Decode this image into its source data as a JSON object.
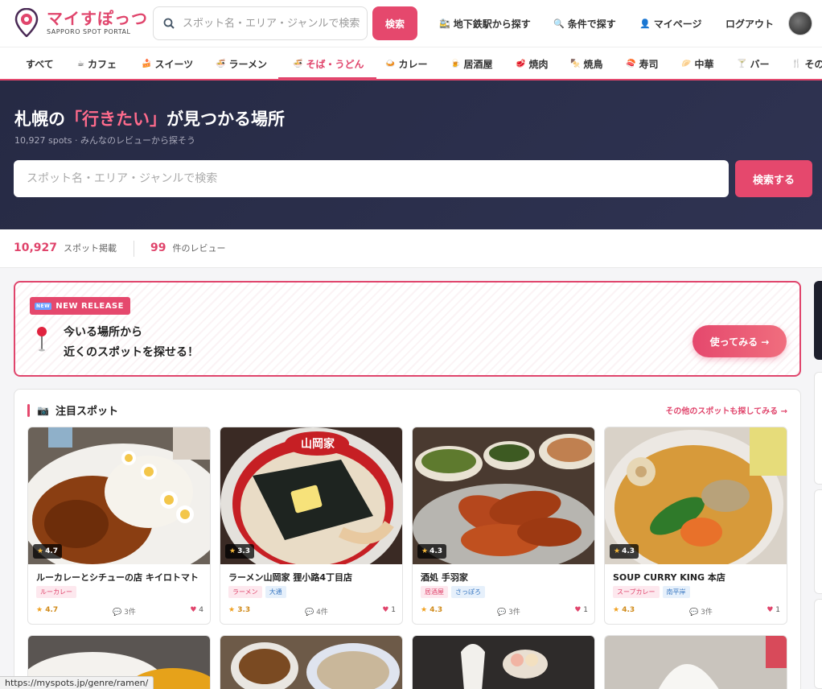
{
  "brand": {
    "name": "マイすぽっつ",
    "subtitle": "SAPPORO SPOT PORTAL"
  },
  "header": {
    "search_placeholder": "スポット名・エリア・ジャンルで検索",
    "search_button": "検索",
    "nav": [
      {
        "icon": "train-icon",
        "label": "地下鉄駅から探す"
      },
      {
        "icon": "search-icon",
        "label": "条件で探す"
      },
      {
        "icon": "user-icon",
        "label": "マイページ"
      },
      {
        "icon": "",
        "label": "ログアウト"
      }
    ]
  },
  "categories": [
    {
      "label": "すべて",
      "emoji": ""
    },
    {
      "label": "カフェ",
      "emoji": "☕"
    },
    {
      "label": "スイーツ",
      "emoji": "🍰"
    },
    {
      "label": "ラーメン",
      "emoji": "🍜"
    },
    {
      "label": "そば・うどん",
      "emoji": "🍜",
      "active": true
    },
    {
      "label": "カレー",
      "emoji": "🍛"
    },
    {
      "label": "居酒屋",
      "emoji": "🍺"
    },
    {
      "label": "焼肉",
      "emoji": "🥩"
    },
    {
      "label": "焼鳥",
      "emoji": "🍢"
    },
    {
      "label": "寿司",
      "emoji": "🍣"
    },
    {
      "label": "中華",
      "emoji": "🥟"
    },
    {
      "label": "バー",
      "emoji": "🍸"
    },
    {
      "label": "その",
      "emoji": "🍴"
    }
  ],
  "hero": {
    "title_pre": "札幌の",
    "title_highlight": "「行きたい」",
    "title_post": "が見つかる場所",
    "sub": "10,927 spots · みんなのレビューから探そう",
    "search_placeholder": "スポット名・エリア・ジャンルで検索",
    "search_button": "検索する"
  },
  "stats": [
    {
      "num": "10,927",
      "label": "スポット掲載"
    },
    {
      "num": "99",
      "label": "件のレビュー"
    }
  ],
  "release": {
    "badge_new": "NEW",
    "badge": "NEW RELEASE",
    "line1": "今いる場所から",
    "line2": "近くのスポットを探せる！",
    "button": "使ってみる →"
  },
  "featured": {
    "title": "注目スポット",
    "more": "その他のスポットも探してみる →",
    "cards": [
      {
        "name": "ルーカレーとシチューの店 キイロトマト",
        "rating": "4.7",
        "tags": [
          {
            "t": "ルーカレー",
            "c": "pink"
          }
        ],
        "reviews": "3件",
        "likes": "4"
      },
      {
        "name": "ラーメン山岡家 狸小路4丁目店",
        "rating": "3.3",
        "tags": [
          {
            "t": "ラーメン",
            "c": "pink"
          },
          {
            "t": "大通",
            "c": "blue"
          }
        ],
        "reviews": "4件",
        "likes": "1"
      },
      {
        "name": "酒処 手羽家",
        "rating": "4.3",
        "tags": [
          {
            "t": "居酒屋",
            "c": "pink"
          },
          {
            "t": "さっぽろ",
            "c": "blue"
          }
        ],
        "reviews": "3件",
        "likes": "1"
      },
      {
        "name": "SOUP CURRY KING 本店",
        "rating": "4.3",
        "tags": [
          {
            "t": "スープカレー",
            "c": "pink"
          },
          {
            "t": "南平岸",
            "c": "blue"
          }
        ],
        "reviews": "3件",
        "likes": "1"
      }
    ]
  },
  "status_url": "https://myspots.jp/genre/ramen/"
}
